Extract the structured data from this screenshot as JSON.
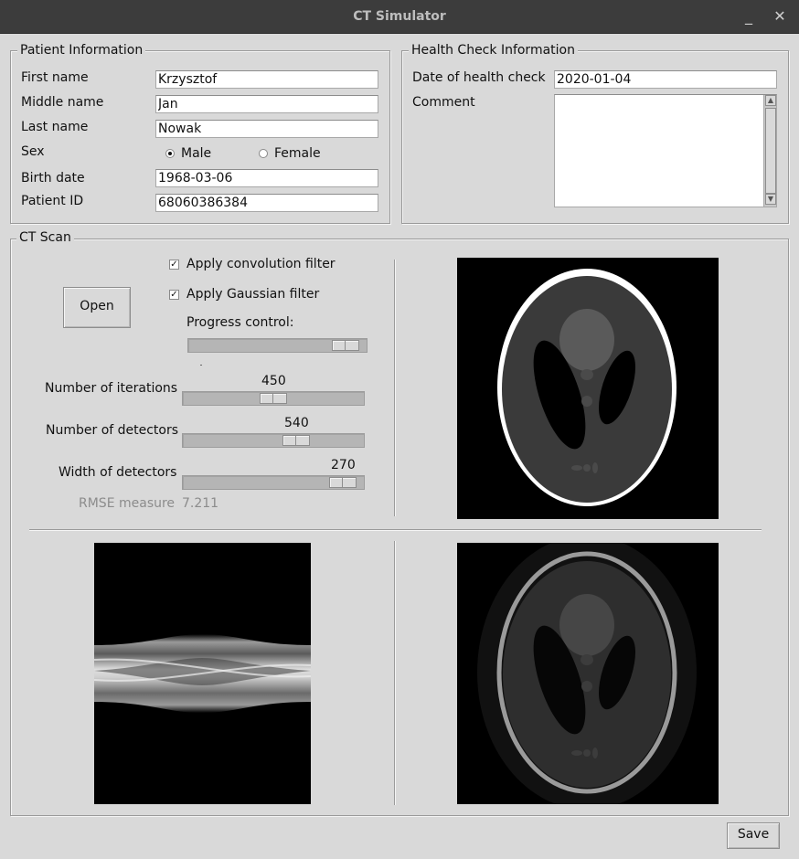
{
  "window": {
    "title": "CT Simulator",
    "minimize_glyph": "_",
    "close_glyph": "✕"
  },
  "patient": {
    "legend": "Patient Information",
    "first_name_label": "First name",
    "first_name": "Krzysztof",
    "middle_name_label": "Middle name",
    "middle_name": "Jan",
    "last_name_label": "Last name",
    "last_name": "Nowak",
    "sex_label": "Sex",
    "sex_options": [
      "Male",
      "Female"
    ],
    "sex_selected": "Male",
    "birth_date_label": "Birth date",
    "birth_date": "1968-03-06",
    "patient_id_label": "Patient ID",
    "patient_id": "68060386384"
  },
  "health": {
    "legend": "Health Check Information",
    "date_label": "Date of health check",
    "date": "2020-01-04",
    "comment_label": "Comment",
    "comment": ""
  },
  "ct": {
    "legend": "CT Scan",
    "open_label": "Open",
    "convolution_label": "Apply convolution filter",
    "convolution_checked": true,
    "gaussian_label": "Apply Gaussian filter",
    "gaussian_checked": true,
    "progress_label": "Progress control:",
    "progress_fraction": 0.95,
    "iterations_label": "Number of iterations",
    "iterations_value": "450",
    "iterations_fraction": 0.5,
    "detectors_label": "Number of detectors",
    "detectors_value": "540",
    "detectors_fraction": 0.65,
    "width_label": "Width of detectors",
    "width_value": "270",
    "width_fraction": 0.95,
    "rmse_label": "RMSE measure",
    "rmse_value": "7.211"
  },
  "footer": {
    "save_label": "Save"
  },
  "colors": {
    "background": "#d9d9d9",
    "titlebar": "#3c3c3c",
    "image_bg": "#000000"
  }
}
